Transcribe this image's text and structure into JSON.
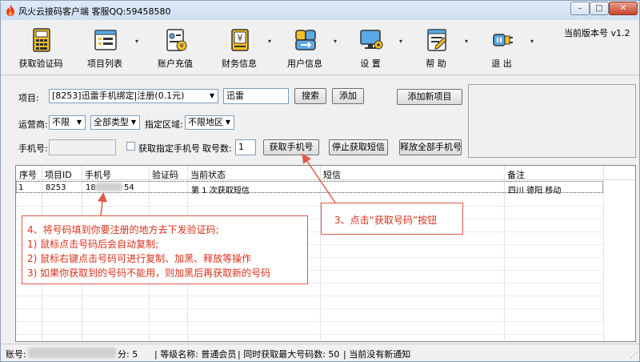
{
  "window": {
    "title": "风火云接码客户端  客服QQ:59458580",
    "minimize": "–",
    "maximize": "□",
    "close": "✕"
  },
  "toolbar": {
    "items": [
      {
        "label": "获取验证码",
        "icon": "calculator-icon",
        "has_arrow": false
      },
      {
        "label": "项目列表",
        "icon": "list-window-icon",
        "has_arrow": true
      },
      {
        "label": "账户充值",
        "icon": "id-card-icon",
        "has_arrow": false
      },
      {
        "label": "财务信息",
        "icon": "finance-document-icon",
        "has_arrow": true
      },
      {
        "label": "用户信息",
        "icon": "user-swap-icon",
        "has_arrow": true
      },
      {
        "label": "设  置",
        "icon": "monitor-settings-icon",
        "has_arrow": true
      },
      {
        "label": "帮  助",
        "icon": "help-document-icon",
        "has_arrow": true
      },
      {
        "label": "退  出",
        "icon": "exit-plug-icon",
        "has_arrow": true
      }
    ],
    "version": "当前版本号 v1.2"
  },
  "form": {
    "project_label": "项目:",
    "project_value": "[8253]迅雷手机绑定|注册(0.1元)",
    "search_value": "迅雷",
    "search_button": "搜索",
    "add_button": "添加",
    "add_project_button": "添加新项目",
    "carrier_label": "运营商:",
    "carrier_value": "不限",
    "type_value": "全部类型",
    "region_label": "指定区域:",
    "region_value": "不限地区",
    "phone_label": "手机号:",
    "specify_phone_label": "获取指定手机号",
    "count_label": "取号数:",
    "count_value": "1",
    "get_phone_button": "获取手机号",
    "stop_sms_button": "停止获取短信",
    "release_all_button": "释放全部手机号"
  },
  "table": {
    "columns": [
      "序号",
      "项目ID",
      "手机号",
      "验证码",
      "当前状态",
      "短信",
      "备注"
    ],
    "rows": [
      [
        "1",
        "8253",
        "18",
        "54",
        "第 1 次获取短信",
        "",
        "四川 德阳 移动"
      ]
    ]
  },
  "annotations": {
    "note1": [
      "4、将号码填到你要注册的地方去下发验证码;",
      "  1) 鼠标点击号码后会自动复制;",
      "  2) 鼠标右键点击号码可进行复制、加黑、释放等操作",
      "  3) 如果你获取到的号码不能用，则加黑后再获取新的号码"
    ],
    "note2": "3、点击“获取号码”按钮",
    "color": "#d8301c"
  },
  "status": {
    "account_label": "账号:",
    "points_text": "分: 5",
    "level_text": "| 等级名称: 普通会员",
    "max_text": "| 同时获取最大号码数: 50",
    "notice_text": "|  当前没有新通知"
  }
}
